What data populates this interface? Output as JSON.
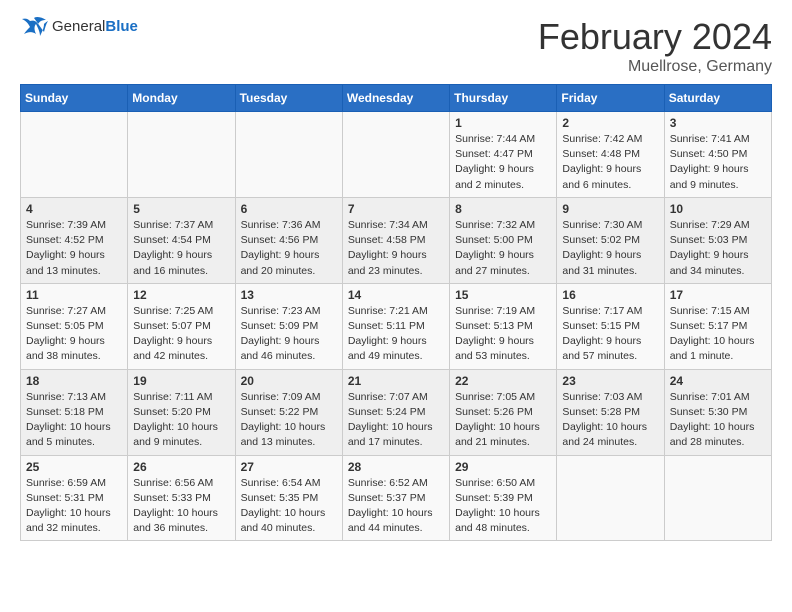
{
  "header": {
    "logo": {
      "general": "General",
      "blue": "Blue"
    },
    "title": "February 2024",
    "location": "Muellrose, Germany"
  },
  "weekdays": [
    "Sunday",
    "Monday",
    "Tuesday",
    "Wednesday",
    "Thursday",
    "Friday",
    "Saturday"
  ],
  "weeks": [
    [
      {
        "day": "",
        "info": ""
      },
      {
        "day": "",
        "info": ""
      },
      {
        "day": "",
        "info": ""
      },
      {
        "day": "",
        "info": ""
      },
      {
        "day": "1",
        "info": "Sunrise: 7:44 AM\nSunset: 4:47 PM\nDaylight: 9 hours\nand 2 minutes."
      },
      {
        "day": "2",
        "info": "Sunrise: 7:42 AM\nSunset: 4:48 PM\nDaylight: 9 hours\nand 6 minutes."
      },
      {
        "day": "3",
        "info": "Sunrise: 7:41 AM\nSunset: 4:50 PM\nDaylight: 9 hours\nand 9 minutes."
      }
    ],
    [
      {
        "day": "4",
        "info": "Sunrise: 7:39 AM\nSunset: 4:52 PM\nDaylight: 9 hours\nand 13 minutes."
      },
      {
        "day": "5",
        "info": "Sunrise: 7:37 AM\nSunset: 4:54 PM\nDaylight: 9 hours\nand 16 minutes."
      },
      {
        "day": "6",
        "info": "Sunrise: 7:36 AM\nSunset: 4:56 PM\nDaylight: 9 hours\nand 20 minutes."
      },
      {
        "day": "7",
        "info": "Sunrise: 7:34 AM\nSunset: 4:58 PM\nDaylight: 9 hours\nand 23 minutes."
      },
      {
        "day": "8",
        "info": "Sunrise: 7:32 AM\nSunset: 5:00 PM\nDaylight: 9 hours\nand 27 minutes."
      },
      {
        "day": "9",
        "info": "Sunrise: 7:30 AM\nSunset: 5:02 PM\nDaylight: 9 hours\nand 31 minutes."
      },
      {
        "day": "10",
        "info": "Sunrise: 7:29 AM\nSunset: 5:03 PM\nDaylight: 9 hours\nand 34 minutes."
      }
    ],
    [
      {
        "day": "11",
        "info": "Sunrise: 7:27 AM\nSunset: 5:05 PM\nDaylight: 9 hours\nand 38 minutes."
      },
      {
        "day": "12",
        "info": "Sunrise: 7:25 AM\nSunset: 5:07 PM\nDaylight: 9 hours\nand 42 minutes."
      },
      {
        "day": "13",
        "info": "Sunrise: 7:23 AM\nSunset: 5:09 PM\nDaylight: 9 hours\nand 46 minutes."
      },
      {
        "day": "14",
        "info": "Sunrise: 7:21 AM\nSunset: 5:11 PM\nDaylight: 9 hours\nand 49 minutes."
      },
      {
        "day": "15",
        "info": "Sunrise: 7:19 AM\nSunset: 5:13 PM\nDaylight: 9 hours\nand 53 minutes."
      },
      {
        "day": "16",
        "info": "Sunrise: 7:17 AM\nSunset: 5:15 PM\nDaylight: 9 hours\nand 57 minutes."
      },
      {
        "day": "17",
        "info": "Sunrise: 7:15 AM\nSunset: 5:17 PM\nDaylight: 10 hours\nand 1 minute."
      }
    ],
    [
      {
        "day": "18",
        "info": "Sunrise: 7:13 AM\nSunset: 5:18 PM\nDaylight: 10 hours\nand 5 minutes."
      },
      {
        "day": "19",
        "info": "Sunrise: 7:11 AM\nSunset: 5:20 PM\nDaylight: 10 hours\nand 9 minutes."
      },
      {
        "day": "20",
        "info": "Sunrise: 7:09 AM\nSunset: 5:22 PM\nDaylight: 10 hours\nand 13 minutes."
      },
      {
        "day": "21",
        "info": "Sunrise: 7:07 AM\nSunset: 5:24 PM\nDaylight: 10 hours\nand 17 minutes."
      },
      {
        "day": "22",
        "info": "Sunrise: 7:05 AM\nSunset: 5:26 PM\nDaylight: 10 hours\nand 21 minutes."
      },
      {
        "day": "23",
        "info": "Sunrise: 7:03 AM\nSunset: 5:28 PM\nDaylight: 10 hours\nand 24 minutes."
      },
      {
        "day": "24",
        "info": "Sunrise: 7:01 AM\nSunset: 5:30 PM\nDaylight: 10 hours\nand 28 minutes."
      }
    ],
    [
      {
        "day": "25",
        "info": "Sunrise: 6:59 AM\nSunset: 5:31 PM\nDaylight: 10 hours\nand 32 minutes."
      },
      {
        "day": "26",
        "info": "Sunrise: 6:56 AM\nSunset: 5:33 PM\nDaylight: 10 hours\nand 36 minutes."
      },
      {
        "day": "27",
        "info": "Sunrise: 6:54 AM\nSunset: 5:35 PM\nDaylight: 10 hours\nand 40 minutes."
      },
      {
        "day": "28",
        "info": "Sunrise: 6:52 AM\nSunset: 5:37 PM\nDaylight: 10 hours\nand 44 minutes."
      },
      {
        "day": "29",
        "info": "Sunrise: 6:50 AM\nSunset: 5:39 PM\nDaylight: 10 hours\nand 48 minutes."
      },
      {
        "day": "",
        "info": ""
      },
      {
        "day": "",
        "info": ""
      }
    ]
  ]
}
